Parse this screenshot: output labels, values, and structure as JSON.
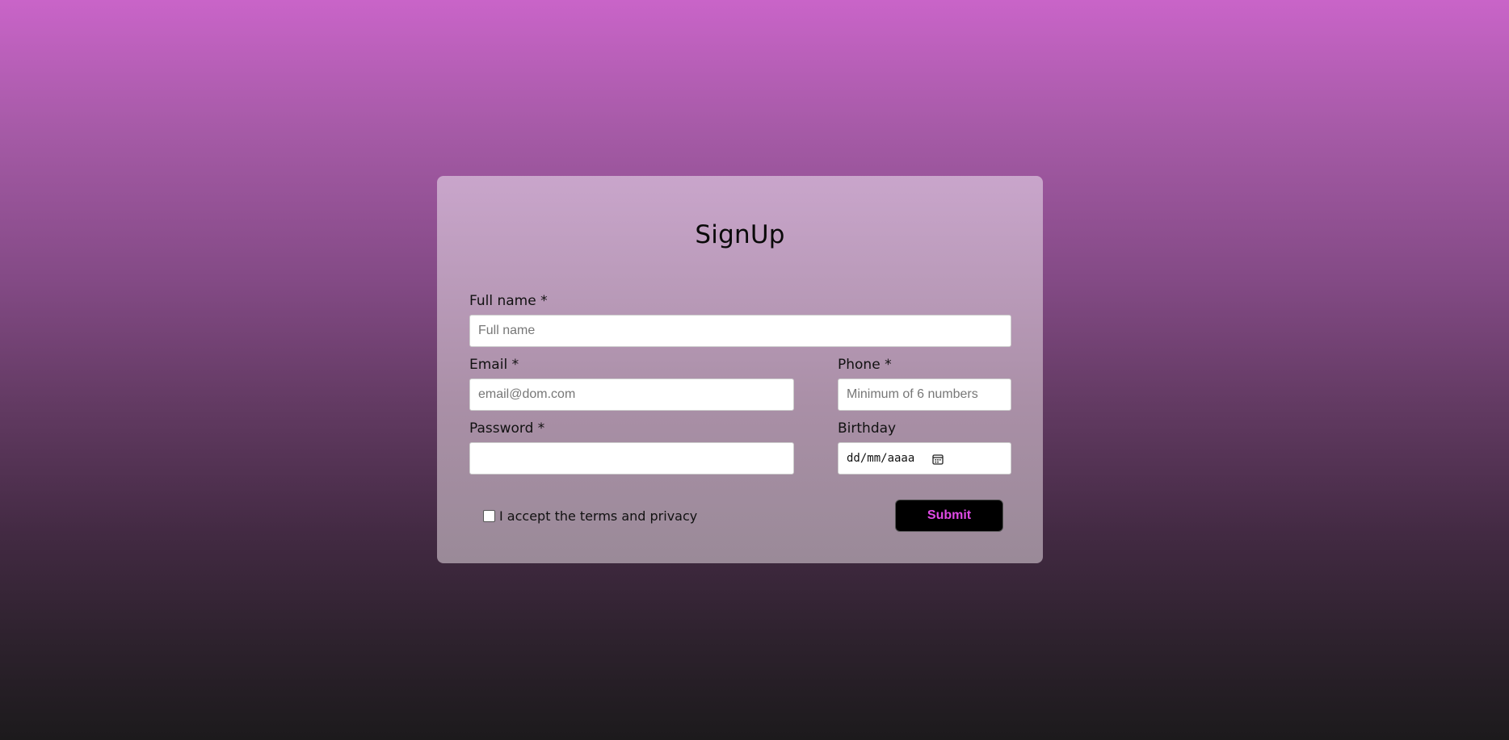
{
  "form": {
    "title": "SignUp",
    "full_name": {
      "label": "Full name *",
      "placeholder": "Full name",
      "value": ""
    },
    "email": {
      "label": "Email *",
      "placeholder": "email@dom.com",
      "value": ""
    },
    "phone": {
      "label": "Phone *",
      "placeholder": "Minimum of 6 numbers",
      "value": ""
    },
    "password": {
      "label": "Password *",
      "value": ""
    },
    "birthday": {
      "label": "Birthday",
      "value": "dd/mm/aaaa",
      "icon": "calendar-icon"
    },
    "terms": {
      "label": "I accept the terms and privacy",
      "checked": false
    },
    "submit_label": "Submit"
  },
  "colors": {
    "submit_text": "#e04ae6",
    "submit_bg": "#000000",
    "background_top": "#c964c8",
    "background_bottom": "#1c1a1c"
  }
}
